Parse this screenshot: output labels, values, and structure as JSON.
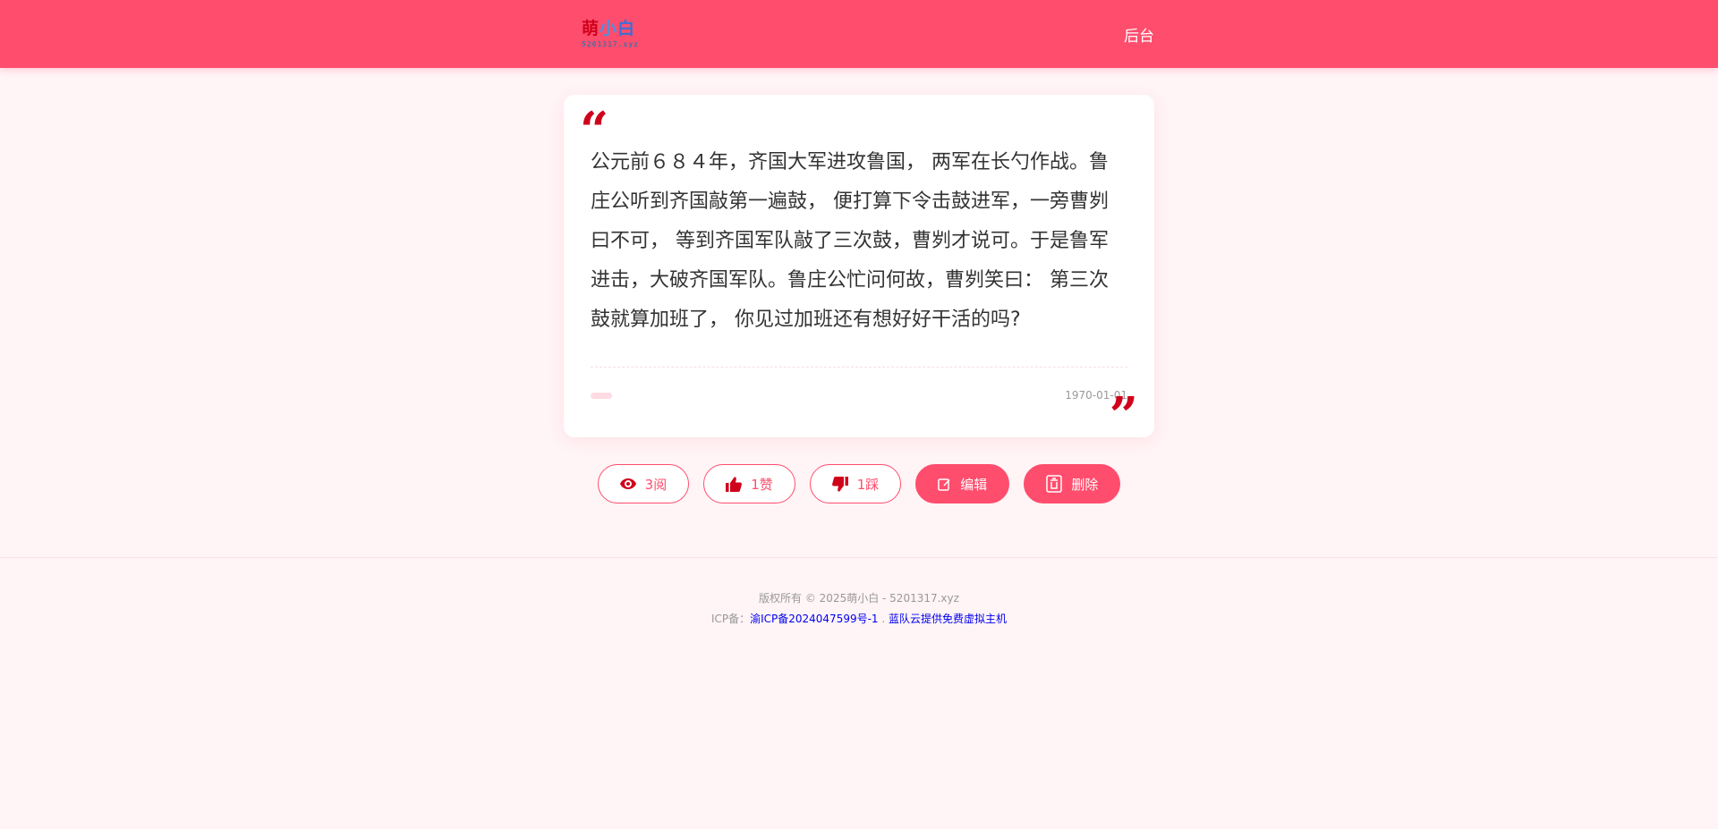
{
  "header": {
    "logo_chars": [
      "萌",
      "小",
      "白"
    ],
    "logo_sub": "5201317.xyz",
    "nav_label": "后台"
  },
  "post": {
    "content": "公元前６８４年，齐国大军进攻鲁国， 两军在长勺作战。鲁庄公听到齐国敲第一遍鼓， 便打算下令击鼓进军，一旁曹刿曰不可， 等到齐国军队敲了三次鼓，曹刿才说可。于是鲁军进击，大破齐国军队。鲁庄公忙问何故，曹刿笑曰： 第三次鼓就算加班了， 你见过加班还有想好好干活的吗?",
    "date": "1970-01-01"
  },
  "actions": {
    "views": "3阅",
    "likes": "1赞",
    "dislikes": "1踩",
    "edit": "编辑",
    "delete": "删除"
  },
  "footer": {
    "copyright": "版权所有 © 2025萌小白 - 5201317.xyz",
    "icp_prefix": "ICP备：",
    "icp_link": "渝ICP备2024047599号-1",
    "separator": ".",
    "host_link": "蓝队云提供免费虚拟主机"
  },
  "colors": {
    "brand": "#ff4d6d",
    "quote_red": "#d0021b",
    "background": "#fff4f6"
  }
}
